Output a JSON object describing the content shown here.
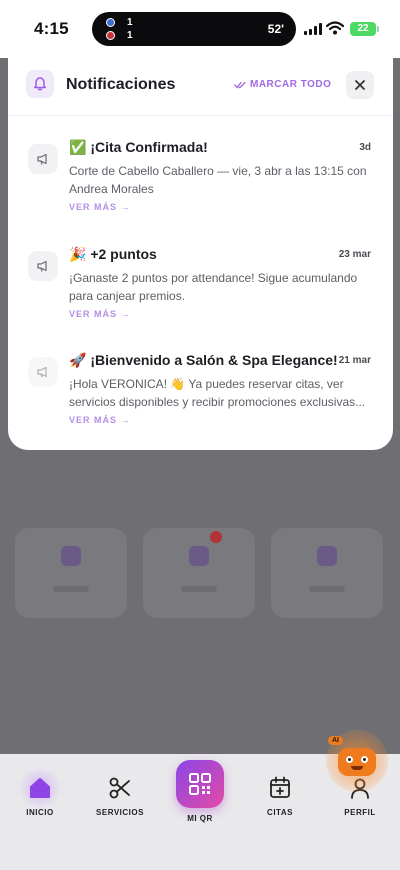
{
  "status_bar": {
    "time": "4:15",
    "match": {
      "team_a_score": "1",
      "team_b_score": "1",
      "minute": "52'"
    },
    "battery": "22"
  },
  "notifications_panel": {
    "title": "Notificaciones",
    "mark_all_label": "MARCAR TODO",
    "items": [
      {
        "title": "✅ ¡Cita Confirmada!",
        "date": "3d",
        "body": "Corte de Cabello Caballero — vie, 3 abr a las 13:15 con Andrea Morales",
        "more_label": "VER MÁS →"
      },
      {
        "title": "🎉 +2 puntos",
        "date": "23 mar",
        "body": "¡Ganaste 2 puntos por attendance! Sigue acumulando para canjear premios.",
        "more_label": "VER MÁS →"
      },
      {
        "title": "🚀 ¡Bienvenido a Salón & Spa Elegance!",
        "date": "21 mar",
        "body": "¡Hola VERONICA! 👋 Ya puedes reservar citas, ver servicios disponibles y recibir promociones exclusivas...",
        "more_label": "VER MÁS →"
      }
    ]
  },
  "bottom_nav": {
    "items": [
      {
        "label": "INICIO",
        "icon": "home-icon"
      },
      {
        "label": "SERVICIOS",
        "icon": "scissors-icon"
      },
      {
        "label": "MI QR",
        "icon": "qr-code-icon"
      },
      {
        "label": "CITAS",
        "icon": "calendar-add-icon"
      },
      {
        "label": "PERFIL",
        "icon": "user-icon"
      }
    ]
  },
  "ai_assistant": {
    "badge": "AI"
  },
  "colors": {
    "accent": "#a06be0",
    "qr_gradient_start": "#8b46e8",
    "qr_gradient_end": "#e34aa6",
    "ai_orange": "#f07a1e"
  }
}
